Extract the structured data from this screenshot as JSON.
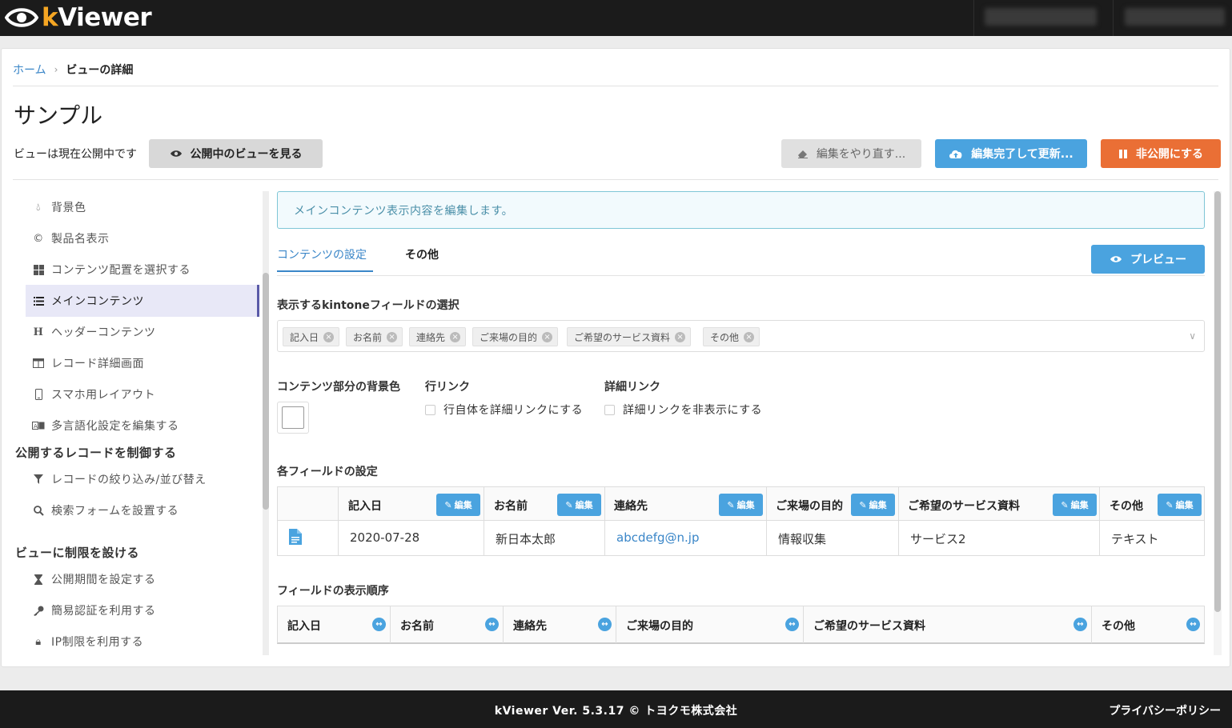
{
  "app": {
    "logo_prefix": "k",
    "logo_rest": "Viewer"
  },
  "breadcrumb": {
    "home": "ホーム",
    "separator": "›",
    "current": "ビューの詳細"
  },
  "page": {
    "title": "サンプル",
    "status": "ビューは現在公開中です"
  },
  "actions": {
    "view_public": "公開中のビューを見る",
    "redo": "編集をやり直す...",
    "update": "編集完了して更新...",
    "unpublish": "非公開にする"
  },
  "sidebar": {
    "items": [
      {
        "label": "背景色",
        "icon": "droplet-icon"
      },
      {
        "label": "製品名表示",
        "icon": "copyright-icon"
      },
      {
        "label": "コンテンツ配置を選択する",
        "icon": "grid-icon"
      },
      {
        "label": "メインコンテンツ",
        "icon": "list-icon"
      },
      {
        "label": "ヘッダーコンテンツ",
        "icon": "heading-icon"
      },
      {
        "label": "レコード詳細画面",
        "icon": "table-icon"
      },
      {
        "label": "スマホ用レイアウト",
        "icon": "mobile-icon"
      },
      {
        "label": "多言語化設定を編集する",
        "icon": "language-icon"
      }
    ],
    "section_records": "公開するレコードを制御する",
    "record_items": [
      {
        "label": "レコードの絞り込み/並び替え",
        "icon": "filter-icon"
      },
      {
        "label": "検索フォームを設置する",
        "icon": "search-icon"
      }
    ],
    "section_restrict": "ビューに制限を設ける",
    "restrict_items": [
      {
        "label": "公開期間を設定する",
        "icon": "hourglass-icon"
      },
      {
        "label": "簡易認証を利用する",
        "icon": "key-icon"
      },
      {
        "label": "IP制限を利用する",
        "icon": "lock-icon"
      }
    ]
  },
  "info": {
    "message": "メインコンテンツ表示内容を編集します。"
  },
  "tabs": {
    "content": "コンテンツの設定",
    "other": "その他"
  },
  "preview": "プレビュー",
  "fields_select": {
    "label": "表示するkintoneフィールドの選択",
    "chips": [
      "記入日",
      "お名前",
      "連絡先",
      "ご来場の目的",
      "ご希望のサービス資料",
      "その他"
    ],
    "remove_glyph": "×",
    "dropdown_glyph": "∨"
  },
  "options": {
    "bg_label": "コンテンツ部分の背景色",
    "row_link_label": "行リンク",
    "row_link_checkbox": "行自体を詳細リンクにする",
    "detail_link_label": "詳細リンク",
    "detail_link_checkbox": "詳細リンクを非表示にする"
  },
  "field_settings": {
    "label": "各フィールドの設定",
    "edit_label": "編集",
    "columns": [
      "記入日",
      "お名前",
      "連絡先",
      "ご来場の目的",
      "ご希望のサービス資料",
      "その他"
    ],
    "row": [
      "2020-07-28",
      "新日本太郎",
      "abcdefg@n.jp",
      "情報収集",
      "サービス2",
      "テキスト"
    ]
  },
  "field_order": {
    "label": "フィールドの表示順序",
    "columns": [
      "記入日",
      "お名前",
      "連絡先",
      "ご来場の目的",
      "ご希望のサービス資料",
      "その他"
    ],
    "arrow_glyph": "↔"
  },
  "footer": {
    "copyright": "kViewer  Ver. 5.3.17  © トヨクモ株式会社",
    "privacy": "プライバシーポリシー"
  },
  "colors": {
    "accent": "#4aa3df",
    "danger": "#ea6f35",
    "link": "#3a86c8",
    "logo_k": "#f5a623"
  }
}
